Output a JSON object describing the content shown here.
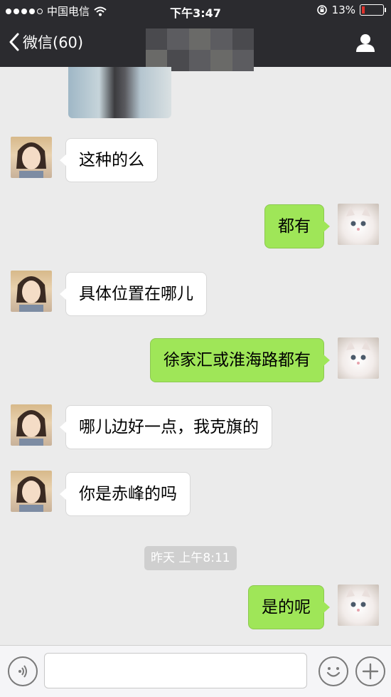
{
  "status_bar": {
    "carrier": "中国电信",
    "time": "下午3:47",
    "battery_percent": "13%",
    "signal_dots_filled": 4
  },
  "nav": {
    "back_label": "微信(60)",
    "contact_icon": "person-icon"
  },
  "messages": [
    {
      "side": "in",
      "text": "这种的么"
    },
    {
      "side": "out",
      "text": "都有"
    },
    {
      "side": "in",
      "text": "具体位置在哪儿"
    },
    {
      "side": "out",
      "text": "徐家汇或淮海路都有"
    },
    {
      "side": "in",
      "text": "哪儿边好一点，我克旗的"
    },
    {
      "side": "in",
      "text": "你是赤峰的吗"
    },
    {
      "side": "out",
      "text": "是的呢"
    }
  ],
  "timestamp": "昨天 上午8:11",
  "input_bar": {
    "voice_icon": "voice-icon",
    "emoji_icon": "emoji-icon",
    "plus_icon": "plus-icon",
    "text_value": ""
  },
  "colors": {
    "nav_bg": "#2b2b2f",
    "outgoing_bubble": "#9fe658",
    "incoming_bubble": "#ffffff",
    "chat_bg": "#ebebeb"
  }
}
